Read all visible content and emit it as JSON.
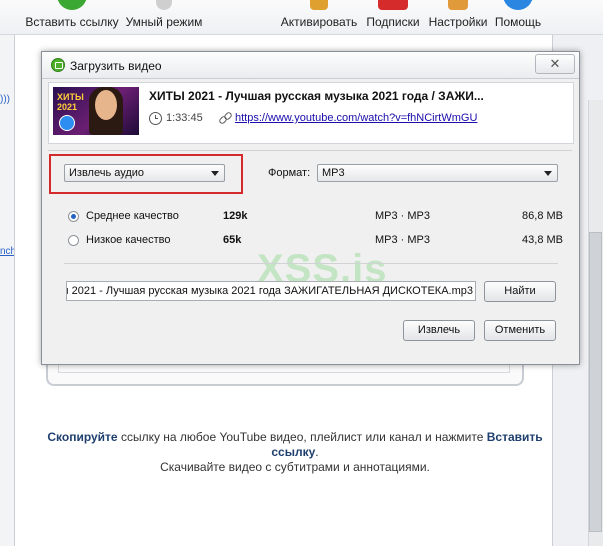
{
  "toolbar": {
    "items": [
      {
        "label": "Вставить ссылку",
        "icon": "paste-link-icon",
        "color": "#3aa832"
      },
      {
        "label": "Умный режим",
        "icon": "smart-mode-bulb-icon",
        "color": "#c9c9c9"
      },
      {
        "label": "Активировать",
        "icon": "activate-key-icon",
        "color": "#e0a030"
      },
      {
        "label": "Подписки",
        "icon": "subscriptions-icon",
        "color": "#d62b2b"
      },
      {
        "label": "Настройки",
        "icon": "settings-tools-icon",
        "color": "#e09a3a"
      },
      {
        "label": "Помощь",
        "icon": "help-icon",
        "color": "#2a86e0"
      }
    ]
  },
  "sidebar": {
    "partial_link": "nch"
  },
  "dialog": {
    "title": "Загрузить видео",
    "close_glyph": "✕",
    "video": {
      "thumbnail_text": "ХИТЫ 2021",
      "title": "ХИТЫ 2021 - Лучшая русская музыка 2021 года / ЗАЖИ...",
      "duration": "1:33:45",
      "url": "https://www.youtube.com/watch?v=fhNCirtWmGU"
    },
    "mode_select": {
      "value": "Извлечь аудио"
    },
    "format": {
      "label": "Формат:",
      "value": "MP3"
    },
    "qualities": [
      {
        "label": "Среднее качество",
        "bitrate": "129k",
        "format": "MP3 · MP3",
        "size": "86,8 MB",
        "selected": true
      },
      {
        "label": "Низкое качество",
        "bitrate": "65k",
        "format": "MP3 · MP3",
        "size": "43,8 MB",
        "selected": false
      }
    ],
    "filename": "ы 2021 - Лучшая русская музыка 2021 года   ЗАЖИГАТЕЛЬНАЯ ДИСКОТЕКА.mp3",
    "browse_button": "Найти",
    "extract_button": "Извлечь",
    "cancel_button": "Отменить"
  },
  "watermark": "XSS.is",
  "hint": {
    "bold1": "Скопируйте",
    "text1": " ссылку на любое YouTube видео, плейлист или канал и нажмите ",
    "bold2": "Вставить ссылку",
    "text2": ".",
    "line2": "Скачивайте видео с субтитрами и аннотациями."
  },
  "colors": {
    "highlight": "#d32b2b",
    "link": "#1a0dab",
    "accent": "#2363c5"
  }
}
